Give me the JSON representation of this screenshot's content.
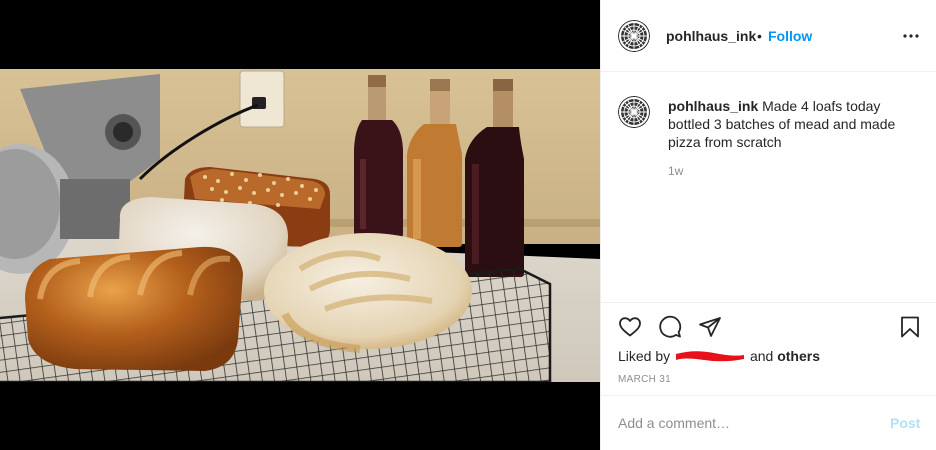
{
  "post": {
    "username": "pohlhaus_ink",
    "follow_separator": "•",
    "follow_label": "Follow",
    "more_icon": "more-options-icon",
    "caption_username": "pohlhaus_ink",
    "caption_text": "Made 4 loafs today bottled 3 batches of mead and made pizza from scratch",
    "time_ago": "1w",
    "liked_by_prefix": "Liked by",
    "liked_by_suffix_and": "and",
    "liked_by_others": "others",
    "date": "MARCH 31"
  },
  "actions": {
    "icons": [
      "heart-icon",
      "comment-icon",
      "share-icon",
      "bookmark-icon"
    ]
  },
  "comment": {
    "placeholder": "Add a comment…",
    "post_label": "Post"
  },
  "colors": {
    "follow": "#0095f6",
    "post_disabled": "#b2dffc",
    "muted": "#8e8e8e",
    "redaction": "#e8101a"
  }
}
